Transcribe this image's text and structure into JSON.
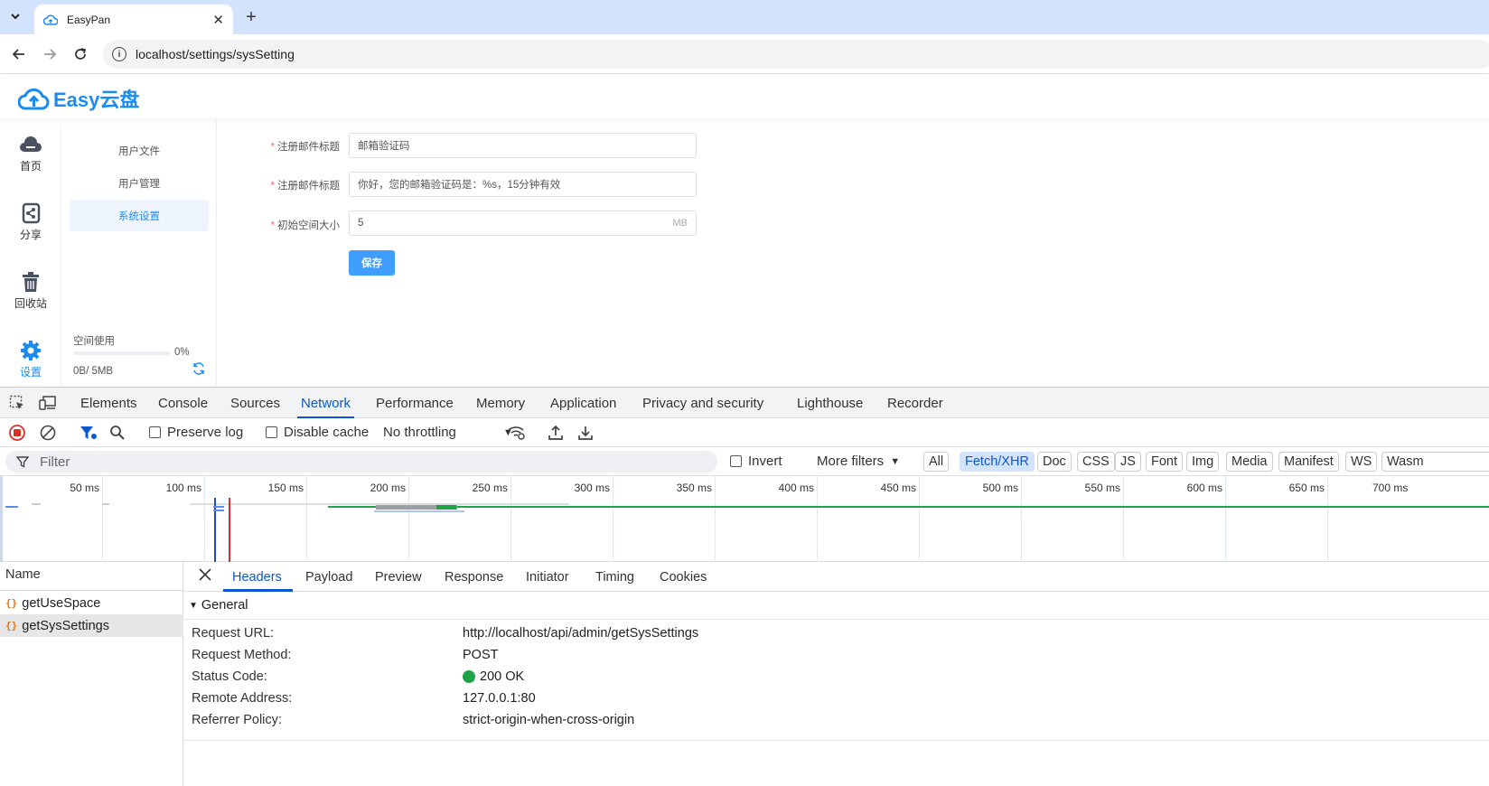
{
  "browser": {
    "tab_title": "EasyPan",
    "url": "localhost/settings/sysSetting"
  },
  "app": {
    "logo_text": "Easy云盘",
    "sidebar": [
      {
        "label": "首页",
        "icon": "cloud-icon"
      },
      {
        "label": "分享",
        "icon": "share-icon"
      },
      {
        "label": "回收站",
        "icon": "trash-icon"
      },
      {
        "label": "设置",
        "icon": "gear-icon",
        "active": true
      }
    ],
    "submenu": [
      {
        "label": "用户文件"
      },
      {
        "label": "用户管理"
      },
      {
        "label": "系统设置",
        "active": true
      }
    ],
    "space": {
      "title": "空间使用",
      "percent": "0%",
      "used": "0B/ 5MB",
      "fraction": 0
    },
    "form": {
      "fields": [
        {
          "label": "注册邮件标题",
          "value": "邮箱验证码"
        },
        {
          "label": "注册邮件标题",
          "value": "你好，您的邮箱验证码是：%s，15分钟有效"
        },
        {
          "label": "初始空间大小",
          "value": "5",
          "suffix": "MB"
        }
      ],
      "save_label": "保存"
    }
  },
  "devtools": {
    "tabs": [
      "Elements",
      "Console",
      "Sources",
      "Network",
      "Performance",
      "Memory",
      "Application",
      "Privacy and security",
      "Lighthouse",
      "Recorder"
    ],
    "active_tab": "Network",
    "toolbar": {
      "preserve_log": "Preserve log",
      "disable_cache": "Disable cache",
      "throttling": "No throttling"
    },
    "filter": {
      "placeholder": "Filter",
      "invert": "Invert",
      "more_filters": "More filters",
      "types": [
        "All",
        "Fetch/XHR",
        "Doc",
        "CSS",
        "JS",
        "Font",
        "Img",
        "Media",
        "Manifest",
        "WS",
        "Wasm"
      ],
      "active_type": "Fetch/XHR"
    },
    "timeline_ticks": [
      "50 ms",
      "100 ms",
      "150 ms",
      "200 ms",
      "250 ms",
      "300 ms",
      "350 ms",
      "400 ms",
      "450 ms",
      "500 ms",
      "550 ms",
      "600 ms",
      "650 ms",
      "700 ms"
    ],
    "name_header": "Name",
    "requests": [
      {
        "name": "getUseSpace"
      },
      {
        "name": "getSysSettings",
        "selected": true
      }
    ],
    "detail_tabs": [
      "Headers",
      "Payload",
      "Preview",
      "Response",
      "Initiator",
      "Timing",
      "Cookies"
    ],
    "active_detail_tab": "Headers",
    "general": {
      "title": "General",
      "rows": [
        {
          "key": "Request URL:",
          "value": "http://localhost/api/admin/getSysSettings"
        },
        {
          "key": "Request Method:",
          "value": "POST"
        },
        {
          "key": "Status Code:",
          "value": "200 OK",
          "status_color": "#1ea446"
        },
        {
          "key": "Remote Address:",
          "value": "127.0.0.1:80"
        },
        {
          "key": "Referrer Policy:",
          "value": "strict-origin-when-cross-origin"
        }
      ]
    }
  }
}
